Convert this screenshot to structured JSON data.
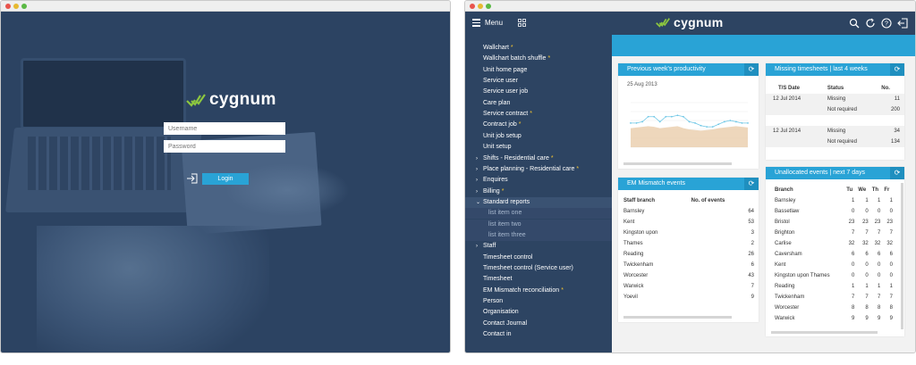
{
  "login": {
    "brand": "cygnum",
    "username_placeholder": "Username",
    "password_placeholder": "Password",
    "login_label": "Login"
  },
  "app": {
    "brand": "cygnum",
    "menu_label": "Menu",
    "icons": [
      "search-icon",
      "refresh-icon",
      "help-icon",
      "logout-icon"
    ],
    "sidebar": [
      {
        "label": "Wallchart",
        "star": "*",
        "arrow": ""
      },
      {
        "label": "Wallchart batch shuffle",
        "star": "*",
        "arrow": ""
      },
      {
        "label": "Unit home page",
        "star": "",
        "arrow": ""
      },
      {
        "label": "Service user",
        "star": "",
        "arrow": ""
      },
      {
        "label": "Service user job",
        "star": "",
        "arrow": ""
      },
      {
        "label": "Care plan",
        "star": "",
        "arrow": ""
      },
      {
        "label": "Service contract",
        "star": "*",
        "arrow": ""
      },
      {
        "label": "Contract job",
        "star": "*",
        "arrow": ""
      },
      {
        "label": "Unit job setup",
        "star": "",
        "arrow": ""
      },
      {
        "label": "Unit setup",
        "star": "",
        "arrow": ""
      },
      {
        "label": "Shifts - Residential care",
        "star": "*",
        "arrow": "›"
      },
      {
        "label": "Place planning - Residential care",
        "star": "*",
        "arrow": "›"
      },
      {
        "label": "Enquires",
        "star": "",
        "arrow": "›"
      },
      {
        "label": "Billing",
        "star": "*",
        "arrow": "›"
      },
      {
        "label": "Standard reports",
        "star": "",
        "arrow": "⌄",
        "active": true
      },
      {
        "label": "list item one",
        "star": "",
        "arrow": "",
        "sub": true
      },
      {
        "label": "list item two",
        "star": "",
        "arrow": "",
        "sub": true
      },
      {
        "label": "list item three",
        "star": "",
        "arrow": "",
        "sub": true
      },
      {
        "label": "Staff",
        "star": "",
        "arrow": "›"
      },
      {
        "label": "Timesheet control",
        "star": "",
        "arrow": ""
      },
      {
        "label": "Timesheet control (Service user)",
        "star": "",
        "arrow": ""
      },
      {
        "label": "Timesheet",
        "star": "",
        "arrow": ""
      },
      {
        "label": "EM Mismatch reconciliation",
        "star": "*",
        "arrow": ""
      },
      {
        "label": "Person",
        "star": "",
        "arrow": ""
      },
      {
        "label": "Organisation",
        "star": "",
        "arrow": ""
      },
      {
        "label": "Contact Journal",
        "star": "",
        "arrow": ""
      },
      {
        "label": "Contact in",
        "star": "",
        "arrow": ""
      }
    ],
    "productivity": {
      "title": "Previous week's productivity",
      "date": "25 Aug 2013"
    },
    "chart_data": {
      "type": "area",
      "title": "",
      "series": [
        {
          "values": [
            38,
            38,
            40,
            48,
            48,
            40,
            48,
            48,
            50,
            48,
            40,
            38,
            34,
            32,
            32,
            36,
            40,
            42,
            40,
            38,
            38
          ]
        },
        {
          "values": [
            30,
            31,
            32,
            33,
            32,
            30,
            31,
            32,
            33,
            30,
            28,
            27,
            26,
            27,
            28,
            30,
            31,
            32,
            33,
            32,
            31
          ]
        }
      ],
      "colors": [
        "#6ec7e6",
        "#e8c9a6"
      ],
      "ylim": [
        0,
        70
      ],
      "grid": true
    },
    "em": {
      "title": "EM Mismatch events",
      "col1": "Staff branch",
      "col2": "No. of events",
      "rows": [
        [
          "Barnsley",
          "64"
        ],
        [
          "Kent",
          "53"
        ],
        [
          "Kingston upon",
          "3"
        ],
        [
          "Thames",
          "2"
        ],
        [
          "Reading",
          "26"
        ],
        [
          "Twickenham",
          "6"
        ],
        [
          "Worcester",
          "43"
        ],
        [
          "Warwick",
          "7"
        ],
        [
          "Yoevil",
          "9"
        ]
      ]
    },
    "missing": {
      "title": "Missing timesheets | last 4 weeks",
      "headers": [
        "T/S Date",
        "Status",
        "No."
      ],
      "rows": [
        [
          "12 Jul 2014",
          "Missing",
          "11"
        ],
        [
          "",
          "Not required",
          "200"
        ],
        [
          "",
          "",
          " "
        ],
        [
          "12 Jul 2014",
          "Missing",
          "34"
        ],
        [
          "",
          "Not required",
          "134"
        ]
      ]
    },
    "unallocated": {
      "title": "Unallocated events | next 7 days",
      "headers": [
        "Branch",
        "Tu",
        "We",
        "Th",
        "Fr"
      ],
      "rows": [
        [
          "Barnsley",
          "1",
          "1",
          "1",
          "1"
        ],
        [
          "Bassetlaw",
          "0",
          "0",
          "0",
          "0"
        ],
        [
          "Bristol",
          "23",
          "23",
          "23",
          "23"
        ],
        [
          "Brighton",
          "7",
          "7",
          "7",
          "7"
        ],
        [
          "Carlise",
          "32",
          "32",
          "32",
          "32"
        ],
        [
          "Caversham",
          "6",
          "6",
          "6",
          "6"
        ],
        [
          "Kent",
          "0",
          "0",
          "0",
          "0"
        ],
        [
          "Kingston upon Thames",
          "0",
          "0",
          "0",
          "0"
        ],
        [
          "Reading",
          "1",
          "1",
          "1",
          "1"
        ],
        [
          "Twickenham",
          "7",
          "7",
          "7",
          "7"
        ],
        [
          "Worcester",
          "8",
          "8",
          "8",
          "8"
        ],
        [
          "Warwick",
          "9",
          "9",
          "9",
          "9"
        ]
      ]
    }
  }
}
